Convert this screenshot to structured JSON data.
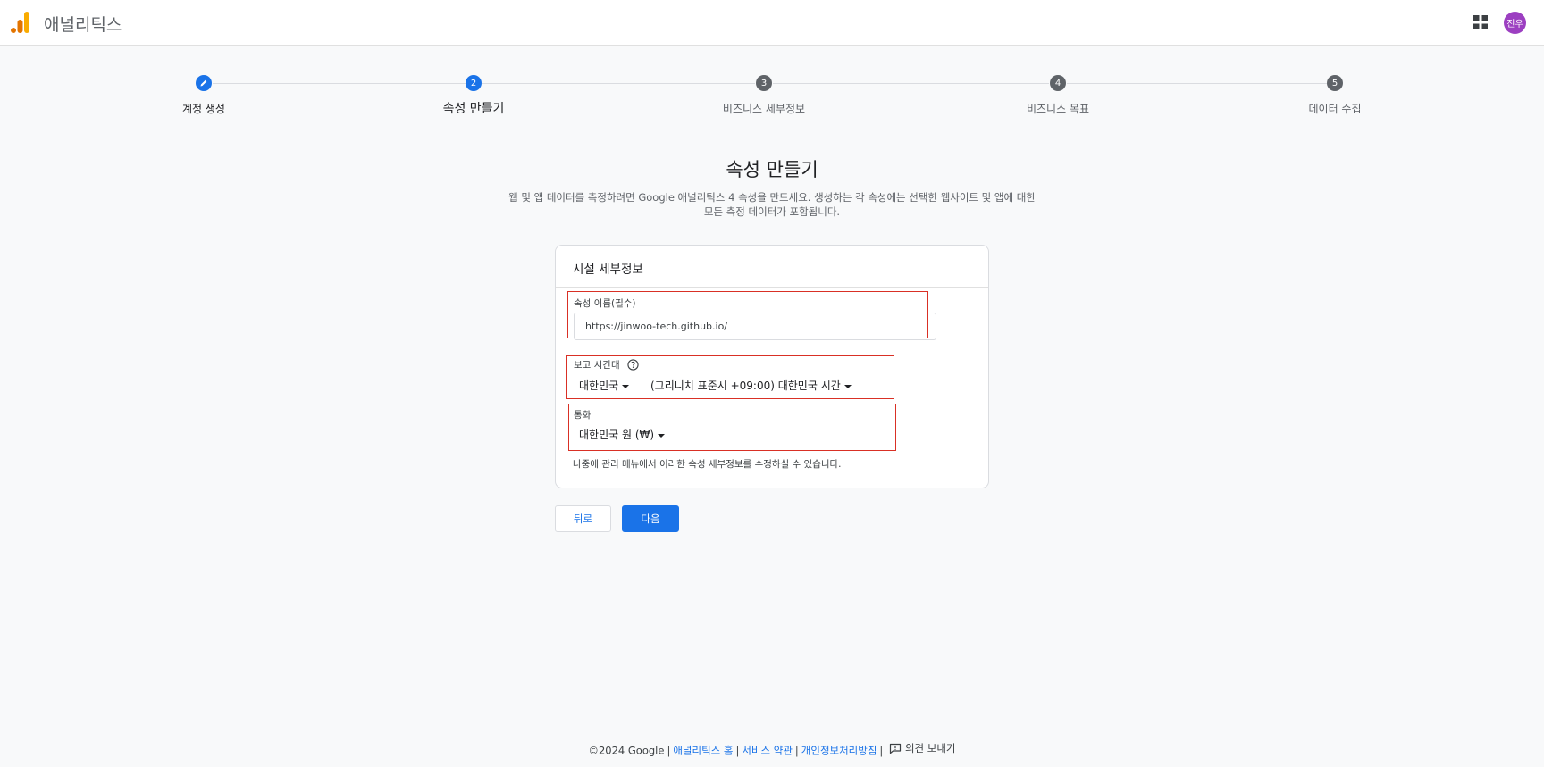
{
  "header": {
    "app_title": "애널리틱스",
    "logo_icon": "analytics-logo-icon",
    "apps_icon": "grid-apps-icon",
    "avatar_text": "진우",
    "avatar_color": "#9c3fc1"
  },
  "stepper": {
    "steps": [
      {
        "number": "",
        "label": "계정 생성",
        "state": "done"
      },
      {
        "number": "2",
        "label": "속성 만들기",
        "state": "current"
      },
      {
        "number": "3",
        "label": "비즈니스 세부정보",
        "state": "upcoming"
      },
      {
        "number": "4",
        "label": "비즈니스 목표",
        "state": "upcoming"
      },
      {
        "number": "5",
        "label": "데이터 수집",
        "state": "upcoming"
      }
    ]
  },
  "page": {
    "title": "속성 만들기",
    "description_line1": "웹 및 앱 데이터를 측정하려면 Google 애널리틱스 4 속성을 만드세요. 생성하는 각 속성에는 선택한 웹사이트 및 앱에 대한",
    "description_line2": "모든 측정 데이터가 포함됩니다."
  },
  "card": {
    "header": "시설 세부정보",
    "property_name": {
      "label": "속성 이름(필수)",
      "value": "https://jinwoo-tech.github.io/"
    },
    "reporting_timezone": {
      "label": "보고 시간대",
      "country": "대한민국",
      "timezone": "(그리니치 표준시 +09:00) 대한민국 시간"
    },
    "currency": {
      "label": "통화",
      "value": "대한민국 원 (₩)"
    },
    "hint": "나중에 관리 메뉴에서 이러한 속성 세부정보를 수정하실 수 있습니다."
  },
  "buttons": {
    "back": "뒤로",
    "next": "다음"
  },
  "footer": {
    "copyright": "©2024 Google",
    "links": [
      "애널리틱스 홈",
      "서비스 약관",
      "개인정보처리방침"
    ],
    "feedback": "의견 보내기"
  },
  "colors": {
    "accent": "#1a73e8",
    "highlight_box": "#d93025",
    "inactive_step": "#5f6368"
  }
}
